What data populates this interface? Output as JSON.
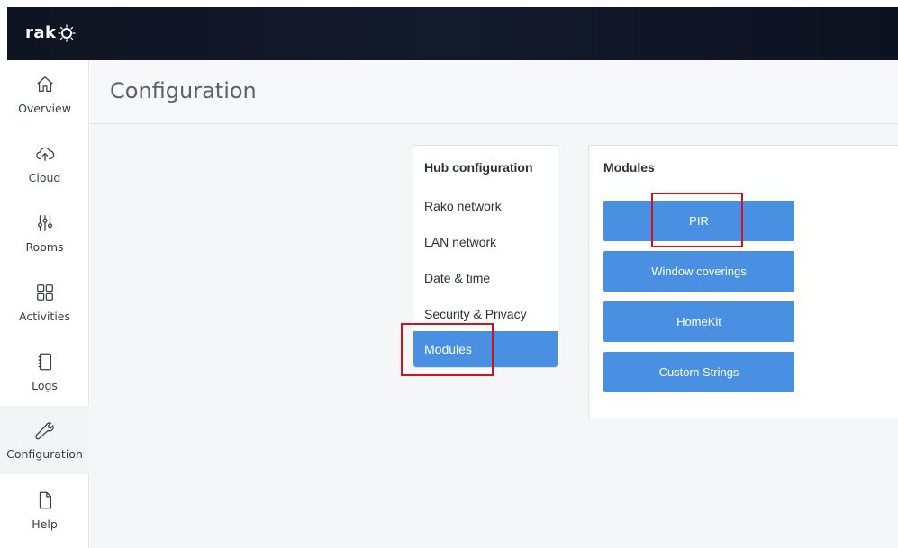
{
  "app": {
    "logo_text": "rak",
    "logo_name": "rako-logo"
  },
  "sidebar": {
    "items": [
      {
        "label": "Overview",
        "icon": "home-icon",
        "active": false
      },
      {
        "label": "Cloud",
        "icon": "cloud-upload-icon",
        "active": false
      },
      {
        "label": "Rooms",
        "icon": "sliders-icon",
        "active": false
      },
      {
        "label": "Activities",
        "icon": "grid-icon",
        "active": false
      },
      {
        "label": "Logs",
        "icon": "notebook-icon",
        "active": false
      },
      {
        "label": "Configuration",
        "icon": "wrench-icon",
        "active": true
      },
      {
        "label": "Help",
        "icon": "document-icon",
        "active": false
      }
    ]
  },
  "header": {
    "title": "Configuration"
  },
  "hub_configuration": {
    "title": "Hub configuration",
    "items": [
      {
        "label": "Rako network",
        "active": false
      },
      {
        "label": "LAN network",
        "active": false
      },
      {
        "label": "Date & time",
        "active": false
      },
      {
        "label": "Security & Privacy",
        "active": false
      },
      {
        "label": "Modules",
        "active": true
      }
    ]
  },
  "modules": {
    "title": "Modules",
    "buttons": [
      {
        "label": "PIR"
      },
      {
        "label": "Window coverings"
      },
      {
        "label": "HomeKit"
      },
      {
        "label": "Custom Strings"
      }
    ]
  },
  "colors": {
    "accent": "#4a90e2",
    "topbar": "#0f1422",
    "highlight": "#d0121b",
    "background": "#f4f6f8"
  }
}
